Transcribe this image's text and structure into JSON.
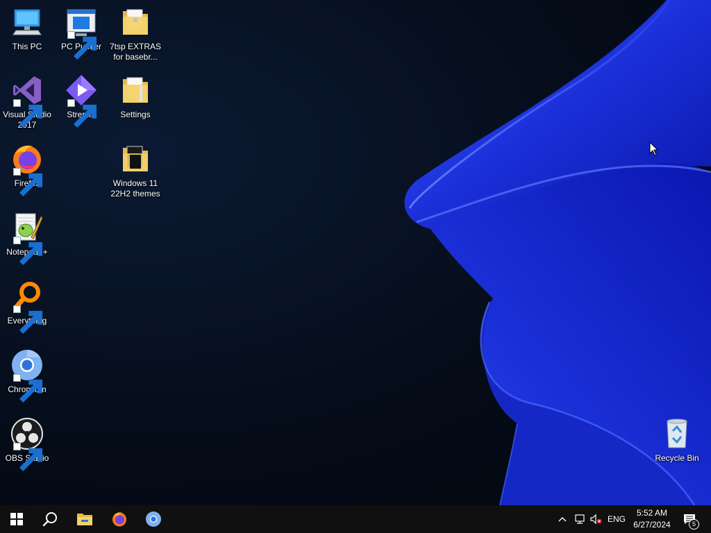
{
  "desktop": {
    "icons": [
      {
        "label": "This PC"
      },
      {
        "label": "PC Purifier"
      },
      {
        "label": "7tsp EXTRAS for basebr..."
      },
      {
        "label": "Visual Studio 2017"
      },
      {
        "label": "Stremio"
      },
      {
        "label": "Settings"
      },
      {
        "label": "Firefox"
      },
      {
        "label": "Windows 11 22H2 themes"
      },
      {
        "label": "Notepad++"
      },
      {
        "label": "Everything"
      },
      {
        "label": "Chromium"
      },
      {
        "label": "OBS Studio"
      },
      {
        "label": "Recycle Bin"
      }
    ]
  },
  "taskbar": {
    "pinned": [
      "start-icon",
      "search-icon",
      "file-explorer-icon",
      "firefox-icon",
      "chromium-icon"
    ],
    "tray": {
      "language": "ENG",
      "time": "5:52 AM",
      "date": "6/27/2024",
      "notification_count": "5"
    }
  },
  "colors": {
    "taskbar": "#101010",
    "wallpaper_blue": "#1a2fd6",
    "desktop_dark": "#06101f"
  }
}
